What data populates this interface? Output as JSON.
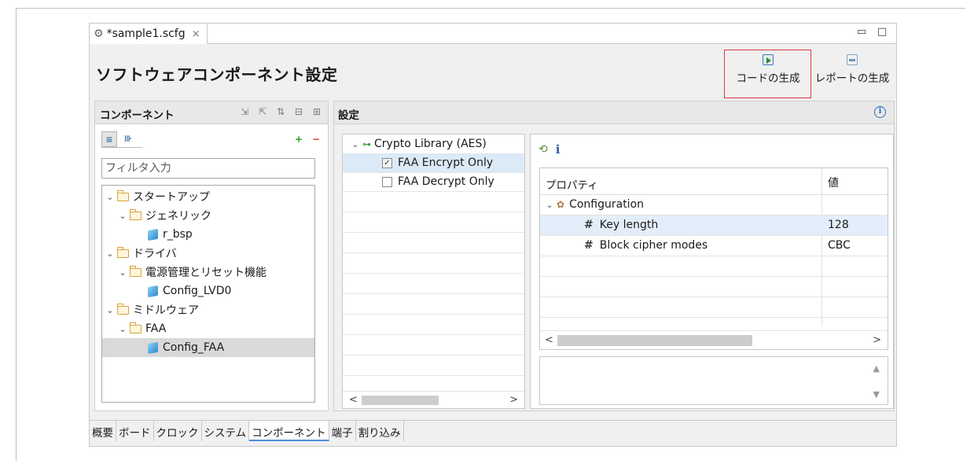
{
  "editor_tab": {
    "title": "*sample1.scfg",
    "close": "×",
    "icon": "gear-icon"
  },
  "window_controls": {
    "minimize": "▭",
    "maximize": "□"
  },
  "header": {
    "title": "ソフトウェアコンポーネント設定",
    "generate_code_label": "コードの生成",
    "generate_report_label": "レポートの生成"
  },
  "components_panel": {
    "title": "コンポーネント",
    "filter_placeholder": "フィルタ入力",
    "tree": [
      {
        "label": "スタートアップ",
        "type": "folder",
        "level": 0,
        "expanded": true
      },
      {
        "label": "ジェネリック",
        "type": "folder",
        "level": 1,
        "expanded": true
      },
      {
        "label": "r_bsp",
        "type": "component",
        "level": 2
      },
      {
        "label": "ドライバ",
        "type": "folder",
        "level": 0,
        "expanded": true
      },
      {
        "label": "電源管理とリセット機能",
        "type": "folder",
        "level": 1,
        "expanded": true
      },
      {
        "label": "Config_LVD0",
        "type": "component",
        "level": 2
      },
      {
        "label": "ミドルウェア",
        "type": "folder",
        "level": 0,
        "expanded": true
      },
      {
        "label": "FAA",
        "type": "folder",
        "level": 1,
        "expanded": true
      },
      {
        "label": "Config_FAA",
        "type": "component",
        "level": 2,
        "selected": true
      }
    ]
  },
  "settings_panel": {
    "title": "設定",
    "list": {
      "root": "Crypto Library (AES)",
      "items": [
        {
          "label": "FAA Encrypt Only",
          "checked": true,
          "selected": true
        },
        {
          "label": "FAA Decrypt Only",
          "checked": false,
          "selected": false
        }
      ]
    },
    "properties": {
      "col_property": "プロパティ",
      "col_value": "値",
      "group": "Configuration",
      "rows": [
        {
          "name": "Key length",
          "value": "128",
          "selected": true
        },
        {
          "name": "Block cipher modes",
          "value": "CBC",
          "selected": false
        }
      ]
    }
  },
  "bottom_tabs": [
    {
      "label": "概要",
      "active": false
    },
    {
      "label": "ボード",
      "active": false
    },
    {
      "label": "クロック",
      "active": false
    },
    {
      "label": "システム",
      "active": false
    },
    {
      "label": "コンポーネント",
      "active": true
    },
    {
      "label": "端子",
      "active": false
    },
    {
      "label": "割り込み",
      "active": false
    }
  ],
  "colors": {
    "highlight": "#e03a3a",
    "selection": "#d9d9d9",
    "accent": "#4a90d9"
  }
}
